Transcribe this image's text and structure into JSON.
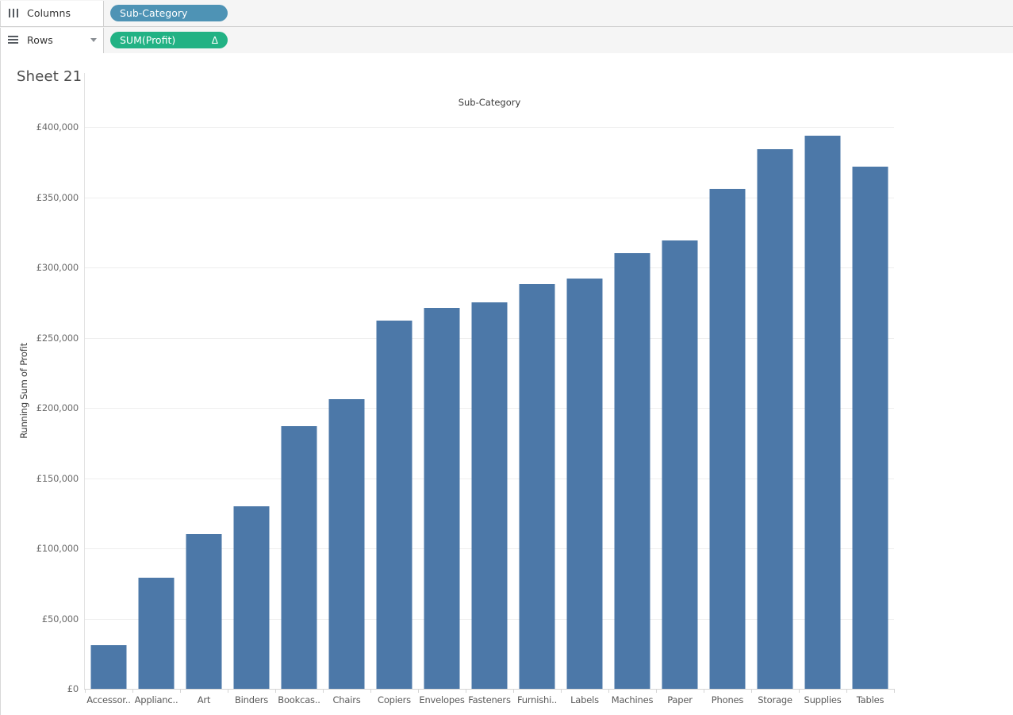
{
  "shelves": {
    "columns": {
      "label": "Columns",
      "icon": "columns-icon",
      "pill": {
        "text": "Sub-Category",
        "type": "dimension",
        "color": "#4e93b5"
      }
    },
    "rows": {
      "label": "Rows",
      "icon": "rows-icon",
      "pill": {
        "text": "SUM(Profit)",
        "type": "measure",
        "color": "#22b284",
        "badge": "Δ",
        "badge_name": "table-calculation-delta"
      }
    }
  },
  "worksheet": {
    "title": "Sheet 21",
    "column_header": "Sub-Category"
  },
  "chart_data": {
    "type": "bar",
    "title": "Sub-Category",
    "xlabel": "Sub-Category",
    "ylabel": "Running Sum of Profit",
    "ylim": [
      0,
      400000
    ],
    "ytick_values": [
      0,
      50000,
      100000,
      150000,
      200000,
      250000,
      300000,
      350000,
      400000
    ],
    "ytick_labels": [
      "£0",
      "£50,000",
      "£100,000",
      "£150,000",
      "£200,000",
      "£250,000",
      "£300,000",
      "£350,000",
      "£400,000"
    ],
    "grid": true,
    "legend": "none",
    "bar_color": "#4c78a8",
    "categories": [
      "Accessor..",
      "Applianc..",
      "Art",
      "Binders",
      "Bookcas..",
      "Chairs",
      "Copiers",
      "Envelopes",
      "Fasteners",
      "Furnishi..",
      "Labels",
      "Machines",
      "Paper",
      "Phones",
      "Storage",
      "Supplies",
      "Tables"
    ],
    "categories_full": [
      "Accessories",
      "Appliances",
      "Art",
      "Binders",
      "Bookcases",
      "Chairs",
      "Copiers",
      "Envelopes",
      "Fasteners",
      "Furnishings",
      "Labels",
      "Machines",
      "Paper",
      "Phones",
      "Storage",
      "Supplies",
      "Tables"
    ],
    "values": [
      31000,
      79000,
      110000,
      130000,
      187000,
      206000,
      262000,
      271000,
      275000,
      288000,
      292000,
      310000,
      319000,
      356000,
      384000,
      394000,
      372000
    ],
    "series": [
      {
        "name": "Running Sum of Profit",
        "values": [
          31000,
          79000,
          110000,
          130000,
          187000,
          206000,
          262000,
          271000,
          275000,
          288000,
          292000,
          310000,
          319000,
          356000,
          384000,
          394000,
          372000
        ]
      }
    ]
  }
}
